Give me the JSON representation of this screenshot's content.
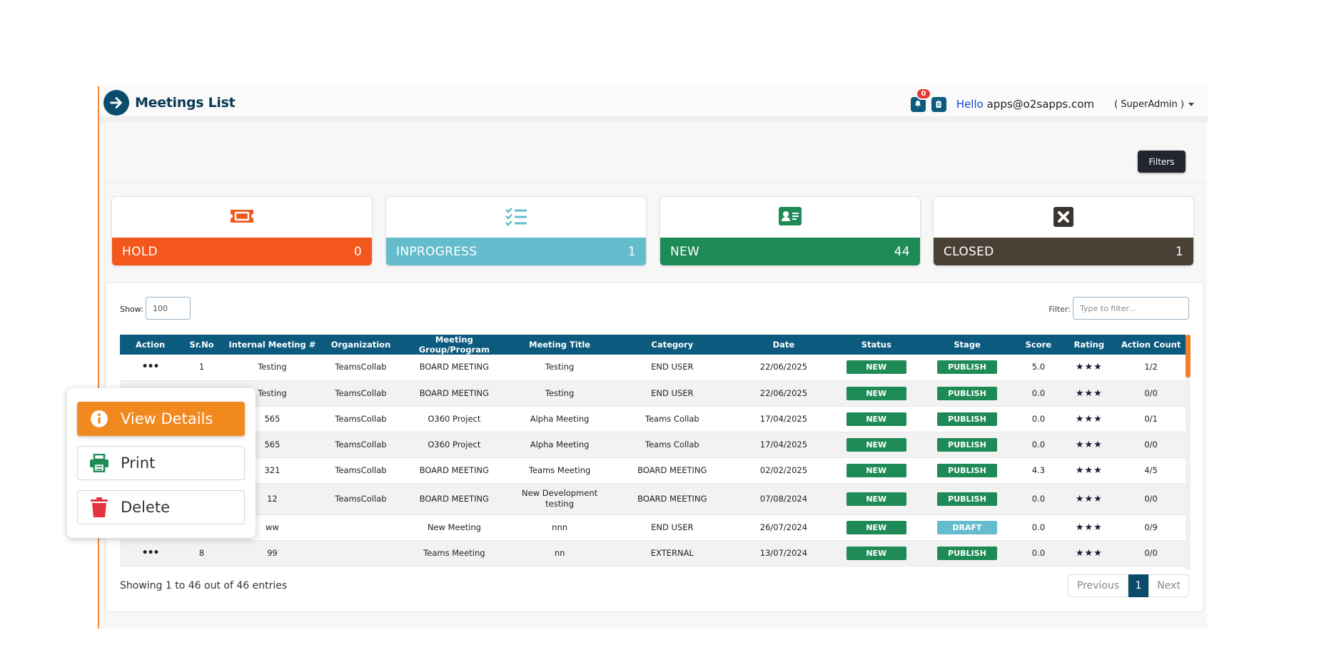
{
  "header": {
    "title": "Meetings List",
    "notification_count": "0",
    "hello_word": "Hello",
    "email": "apps@o2sapps.com",
    "role": "( SuperAdmin )"
  },
  "filters_button": "Filters",
  "cards": [
    {
      "label": "HOLD",
      "count": "0",
      "color": "#f4571c",
      "icon": "ticket-icon"
    },
    {
      "label": "INPROGRESS",
      "count": "1",
      "color": "#64bccc",
      "icon": "checklist-icon"
    },
    {
      "label": "NEW",
      "count": "44",
      "color": "#1e8a55",
      "icon": "id-card-icon"
    },
    {
      "label": "CLOSED",
      "count": "1",
      "color": "#4a4035",
      "icon": "close-square-icon"
    }
  ],
  "table_controls": {
    "show_label": "Show:",
    "show_value": "100",
    "filter_label": "Filter:",
    "filter_placeholder": "Type to filter..."
  },
  "columns": [
    "Action",
    "Sr.No",
    "Internal Meeting #",
    "Organization",
    "Meeting Group/Program",
    "Meeting Title",
    "Category",
    "Date",
    "Status",
    "Stage",
    "Score",
    "Rating",
    "Action Count"
  ],
  "rows": [
    {
      "action": "•••",
      "sr": "1",
      "internal": "Testing",
      "org": "TeamsCollab",
      "group": "BOARD MEETING",
      "title": "Testing",
      "category": "END USER",
      "date": "22/06/2025",
      "status": "NEW",
      "stage": "PUBLISH",
      "score": "5.0",
      "rating": "★★★",
      "count": "1/2"
    },
    {
      "action": "",
      "sr": "",
      "internal": "Testing",
      "org": "TeamsCollab",
      "group": "BOARD MEETING",
      "title": "Testing",
      "category": "END USER",
      "date": "22/06/2025",
      "status": "NEW",
      "stage": "PUBLISH",
      "score": "0.0",
      "rating": "★★★",
      "count": "0/0"
    },
    {
      "action": "",
      "sr": "",
      "internal": "565",
      "org": "TeamsCollab",
      "group": "O360 Project",
      "title": "Alpha Meeting",
      "category": "Teams Collab",
      "date": "17/04/2025",
      "status": "NEW",
      "stage": "PUBLISH",
      "score": "0.0",
      "rating": "★★★",
      "count": "0/1"
    },
    {
      "action": "",
      "sr": "",
      "internal": "565",
      "org": "TeamsCollab",
      "group": "O360 Project",
      "title": "Alpha Meeting",
      "category": "Teams Collab",
      "date": "17/04/2025",
      "status": "NEW",
      "stage": "PUBLISH",
      "score": "0.0",
      "rating": "★★★",
      "count": "0/0"
    },
    {
      "action": "",
      "sr": "",
      "internal": "321",
      "org": "TeamsCollab",
      "group": "BOARD MEETING",
      "title": "Teams Meeting",
      "category": "BOARD MEETING",
      "date": "02/02/2025",
      "status": "NEW",
      "stage": "PUBLISH",
      "score": "4.3",
      "rating": "★★★",
      "count": "4/5"
    },
    {
      "action": "",
      "sr": "",
      "internal": "12",
      "org": "TeamsCollab",
      "group": "BOARD MEETING",
      "title": "New Development testing",
      "category": "BOARD MEETING",
      "date": "07/08/2024",
      "status": "NEW",
      "stage": "PUBLISH",
      "score": "0.0",
      "rating": "★★★",
      "count": "0/0"
    },
    {
      "action": "",
      "sr": "",
      "internal": "ww",
      "org": "",
      "group": "New Meeting",
      "title": "nnn",
      "category": "END USER",
      "date": "26/07/2024",
      "status": "NEW",
      "stage": "DRAFT",
      "score": "0.0",
      "rating": "★★★",
      "count": "0/9"
    },
    {
      "action": "•••",
      "sr": "8",
      "internal": "99",
      "org": "",
      "group": "Teams Meeting",
      "title": "nn",
      "category": "EXTERNAL",
      "date": "13/07/2024",
      "status": "NEW",
      "stage": "PUBLISH",
      "score": "0.0",
      "rating": "★★★",
      "count": "0/0"
    }
  ],
  "colors": {
    "status_new": "#1e8a55",
    "stage_publish": "#1e8a55",
    "stage_draft": "#64bccc"
  },
  "footer": {
    "showing": "Showing 1 to 46 out of 46 entries",
    "previous": "Previous",
    "page": "1",
    "next": "Next"
  },
  "context_menu": {
    "view_details": "View Details",
    "print": "Print",
    "delete": "Delete"
  }
}
